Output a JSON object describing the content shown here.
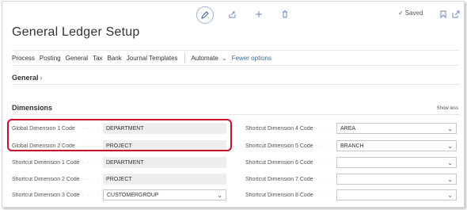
{
  "window": {
    "saved_label": "Saved"
  },
  "page": {
    "title": "General Ledger Setup"
  },
  "actions": {
    "items": [
      "Process",
      "Posting",
      "General",
      "Tax",
      "Bank",
      "Journal Templates"
    ],
    "automate": "Automate",
    "fewer_options": "Fewer options"
  },
  "sections": {
    "general": "General",
    "dimensions": "Dimensions",
    "show_less": "Show less"
  },
  "left_fields": [
    {
      "label": "Global Dimension 1 Code",
      "value": "DEPARTMENT"
    },
    {
      "label": "Global Dimension 2 Code",
      "value": "PROJECT"
    },
    {
      "label": "Shortcut Dimension 1 Code",
      "value": "DEPARTMENT"
    },
    {
      "label": "Shortcut Dimension 2 Code",
      "value": "PROJECT"
    },
    {
      "label": "Shortcut Dimension 3 Code",
      "value": "CUSTOMERGROUP"
    }
  ],
  "right_fields": [
    {
      "label": "Shortcut Dimension 4 Code",
      "value": "AREA"
    },
    {
      "label": "Shortcut Dimension 5 Code",
      "value": "BRANCH"
    },
    {
      "label": "Shortcut Dimension 6 Code",
      "value": ""
    },
    {
      "label": "Shortcut Dimension 7 Code",
      "value": ""
    },
    {
      "label": "Shortcut Dimension 8 Code",
      "value": ""
    }
  ],
  "colors": {
    "highlight": "#c8102e",
    "link": "#3b6ba5",
    "icon": "#2f5e9c"
  }
}
